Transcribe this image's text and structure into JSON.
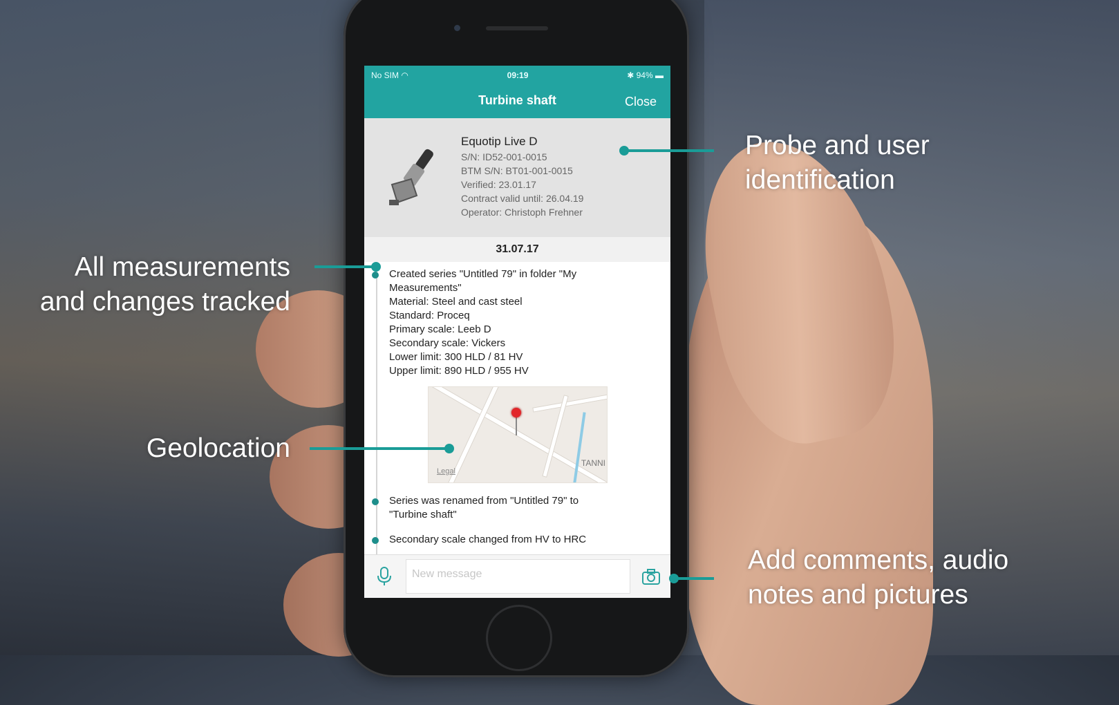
{
  "status": {
    "carrier": "No SIM",
    "time": "09:19",
    "battery": "94%"
  },
  "nav": {
    "title": "Turbine shaft",
    "close_label": "Close"
  },
  "probe": {
    "name": "Equotip Live D",
    "lines": [
      "S/N: ID52-001-0015",
      "BTM S/N: BT01-001-0015",
      "Verified: 23.01.17",
      "Contract valid until: 26.04.19",
      "Operator: Christoph Frehner"
    ]
  },
  "date": "31.07.17",
  "entries": [
    {
      "lines": [
        "Created series \"Untitled 79\" in folder \"My",
        "Measurements\"",
        "Material: Steel and cast steel",
        "Standard: Proceq",
        "Primary scale: Leeb D",
        "Secondary scale: Vickers",
        "Lower limit: 300 HLD / 81 HV",
        "Upper limit: 890 HLD / 955 HV"
      ]
    },
    {
      "lines": [
        "Series was renamed from \"Untitled 79\" to",
        "\"Turbine shaft\""
      ]
    },
    {
      "lines": [
        "Secondary scale changed from HV to HRC"
      ]
    }
  ],
  "map": {
    "legal": "Legal",
    "street": "TANNI"
  },
  "message": {
    "placeholder": "New message"
  },
  "annotations": {
    "probe_id": [
      "Probe and user",
      "identification"
    ],
    "tracked": [
      "All measurements",
      "and changes tracked"
    ],
    "geo": "Geolocation",
    "comments": [
      "Add comments, audio",
      "notes and pictures"
    ]
  },
  "colors": {
    "accent": "#22a4a1",
    "connector": "#1a9c97"
  },
  "icons": {
    "mic": "microphone-icon",
    "camera": "camera-icon",
    "wifi": "wifi-icon",
    "battery": "battery-icon",
    "bluetooth": "bluetooth-icon",
    "pin": "map-pin-icon"
  }
}
